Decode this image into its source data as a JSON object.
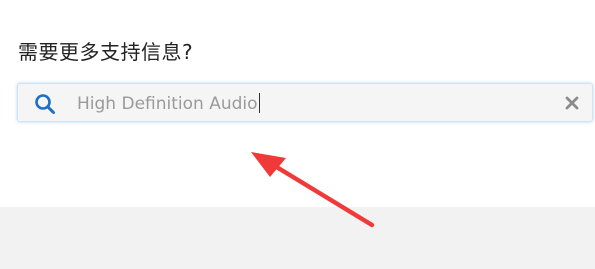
{
  "heading": "需要更多支持信息?",
  "search": {
    "value": "High Definition Audio",
    "icon": "search-icon",
    "clear_icon": "close-icon"
  },
  "colors": {
    "accent": "#1f6fc5",
    "annotation_arrow": "#f03a3a"
  }
}
